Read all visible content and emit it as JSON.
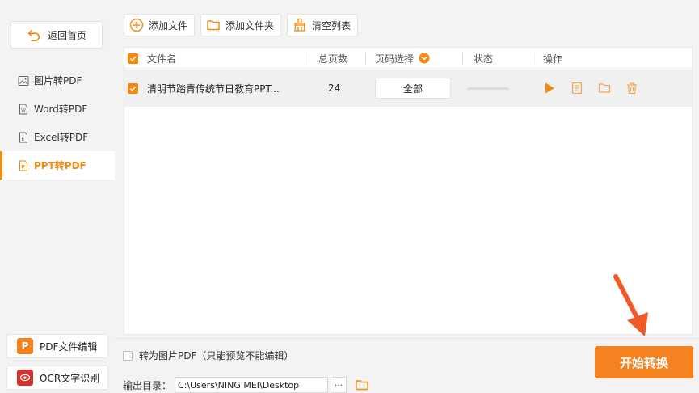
{
  "sidebar": {
    "back_label": "返回首页",
    "items": [
      {
        "label": "图片转PDF",
        "icon": "image-icon",
        "active": false
      },
      {
        "label": "Word转PDF",
        "icon": "word-file-icon",
        "active": false
      },
      {
        "label": "Excel转PDF",
        "icon": "excel-file-icon",
        "active": false
      },
      {
        "label": "PPT转PDF",
        "icon": "ppt-file-icon",
        "active": true
      }
    ],
    "pdf_edit_label": "PDF文件编辑",
    "ocr_label": "OCR文字识别"
  },
  "toolbar": {
    "add_file_label": "添加文件",
    "add_folder_label": "添加文件夹",
    "clear_list_label": "清空列表"
  },
  "table": {
    "headers": {
      "filename": "文件名",
      "total_pages": "总页数",
      "page_select": "页码选择",
      "status": "状态",
      "action": "操作"
    },
    "rows": [
      {
        "filename": "清明节踏青传统节日教育PPT...",
        "pages": "24",
        "page_select": "全部"
      }
    ]
  },
  "footer": {
    "img_pdf_label": "转为图片PDF（只能预览不能编辑）",
    "output_label": "输出目录：",
    "output_path": "C:\\Users\\NING MEI\\Desktop",
    "more_label": "···",
    "start_label": "开始转换"
  },
  "colors": {
    "accent": "#f28a0f",
    "start_button": "#f5821f",
    "arrow": "#f05a28"
  }
}
